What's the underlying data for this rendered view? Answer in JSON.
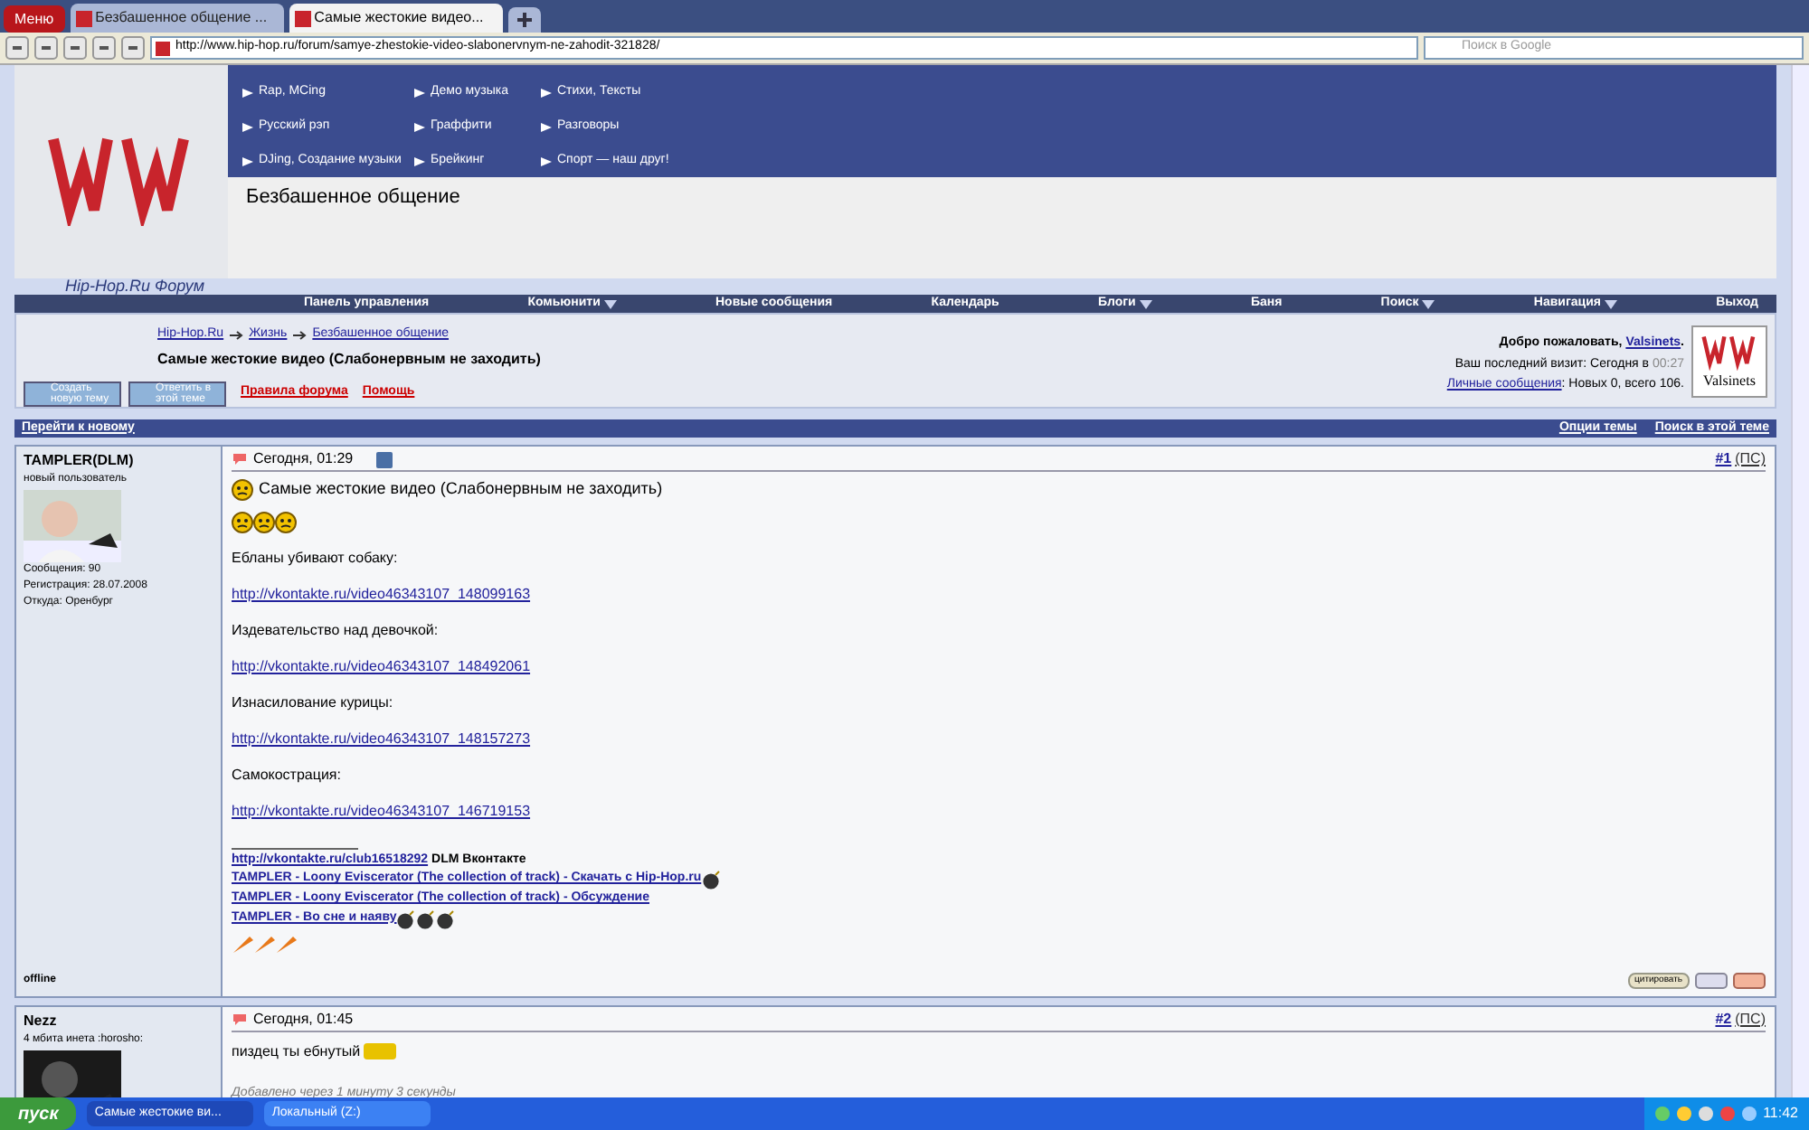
{
  "browser": {
    "menu_label": "Меню",
    "tabs": [
      {
        "label": "Безбашенное общение ...",
        "selected": false
      },
      {
        "label": "Самые жестокие видео...",
        "selected": true
      }
    ],
    "url": "http://www.hip-hop.ru/forum/samye-zhestokie-video-slabonervnym-ne-zahodit-321828/",
    "search_placeholder": "Поиск в Google"
  },
  "header": {
    "links": [
      "Rap, MCing",
      "Русский рэп",
      "DJing, Создание музыки",
      "Демо музыка",
      "Граффити",
      "Брейкинг",
      "Стихи, Тексты",
      "Разговоры",
      "Спорт — наш друг!"
    ],
    "section_title": "Безбашенное общение",
    "forum_name": "Hip-Hop.Ru Форум"
  },
  "nav": [
    {
      "label": "Панель управления",
      "dropdown": false
    },
    {
      "label": "Комьюнити",
      "dropdown": true
    },
    {
      "label": "Новые сообщения",
      "dropdown": false
    },
    {
      "label": "Календарь",
      "dropdown": false
    },
    {
      "label": "Блоги",
      "dropdown": true
    },
    {
      "label": "Баня",
      "dropdown": false
    },
    {
      "label": "Поиск",
      "dropdown": true
    },
    {
      "label": "Навигация",
      "dropdown": true
    },
    {
      "label": "Выход",
      "dropdown": false
    }
  ],
  "breadcrumbs": [
    "Hip-Hop.Ru",
    "Жизнь",
    "Безбашенное общение"
  ],
  "thread_title": "Самые жестокие видео (Слабонервным не заходить)",
  "actions": [
    {
      "label": "Создать новую тему"
    },
    {
      "label": "Ответить в этой теме"
    }
  ],
  "help_links": [
    "Правила форума",
    "Помощь"
  ],
  "welcome": {
    "greeting": "Добро пожаловать,",
    "user": "Valsinets",
    "user_suffix": ".",
    "last_visit": "Ваш последний визит: Сегодня в",
    "last_visit_time": "00:27",
    "pm_link": "Личные сообщения",
    "pm_text": ": Новых 0, всего 106.",
    "avatar_label": "Valsinets"
  },
  "bar": {
    "left": "Перейти к новому",
    "right": [
      "Опции темы",
      "Поиск в этой теме"
    ]
  },
  "posts": [
    {
      "author": "TAMPLER(DLM)",
      "rank": "новый пользователь",
      "stats": [
        "Сообщения: 90",
        "Регистрация: 28.07.2008",
        "Откуда: Оренбург"
      ],
      "status": "offline",
      "date": "Сегодня, 01:29",
      "number": "#1",
      "ps": "(ПС)",
      "title": "Самые жестокие видео (Слабонервным не заходить)",
      "body": [
        {
          "kind": "smileys"
        },
        {
          "kind": "text",
          "text": "Ебланы убивают собаку:"
        },
        {
          "kind": "link",
          "text": "http://vkontakte.ru/video46343107_148099163"
        },
        {
          "kind": "text",
          "text": "Издевательство над девочкой:"
        },
        {
          "kind": "link",
          "text": "http://vkontakte.ru/video46343107_148492061"
        },
        {
          "kind": "text",
          "text": "Изнасилование курицы:"
        },
        {
          "kind": "link",
          "text": "http://vkontakte.ru/video46343107_148157273"
        },
        {
          "kind": "text",
          "text": "Самокострация:"
        },
        {
          "kind": "link",
          "text": "http://vkontakte.ru/video46343107_146719153"
        }
      ],
      "signature": [
        {
          "link": "http://vkontakte.ru/club16518292",
          "after": "DLM Вконтакте"
        },
        {
          "link": "TAMPLER - Loony Eviscerator (The collection of track) - Скачать с Hip-Hop.ru",
          "icons": [
            {
              "kind": "bomb"
            }
          ]
        },
        {
          "link": "TAMPLER - Loony Eviscerator (The collection of track) - Обсуждение"
        },
        {
          "link": "TAMPLER - Во сне и наяву",
          "icons": [
            {
              "kind": "bomb"
            },
            {
              "kind": "bomb"
            },
            {
              "kind": "bomb"
            }
          ]
        }
      ],
      "quote_label": "цитировать"
    },
    {
      "author": "Nezz",
      "rank": "4 мбита инета :horosho:",
      "date": "Сегодня, 01:45",
      "number": "#2",
      "ps": "(ПС)",
      "body": [
        {
          "kind": "text",
          "text": "пиздец ты ебнутый"
        }
      ],
      "added": "Добавлено через 1 минуту 3 секунды"
    }
  ],
  "taskbar": {
    "start": "пуск",
    "tasks": [
      {
        "label": "Самые жестокие ви...",
        "selected": true
      },
      {
        "label": "Локальный  (Z:)",
        "selected": false
      }
    ],
    "clock": "11:42"
  }
}
